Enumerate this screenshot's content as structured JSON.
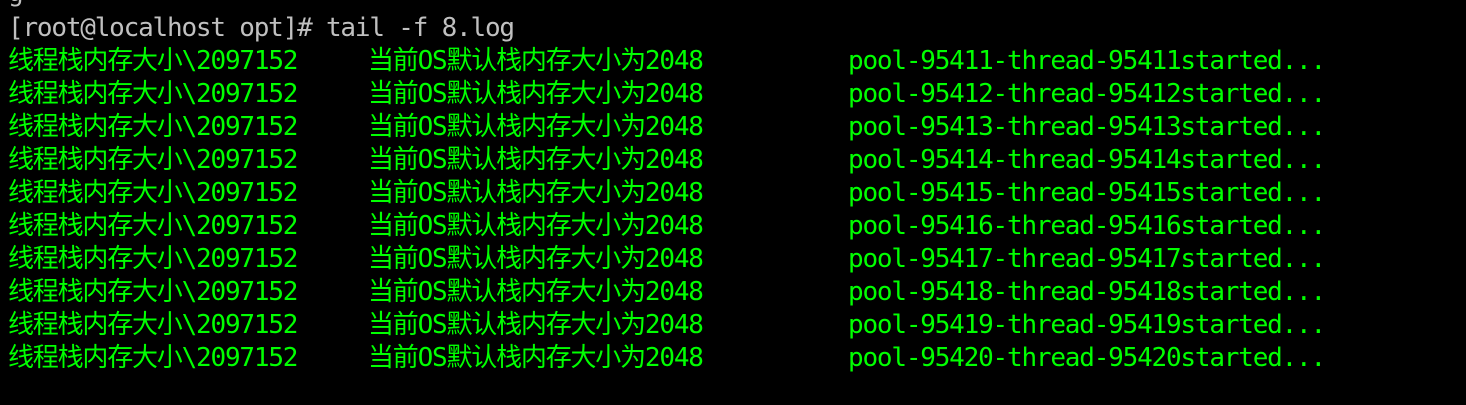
{
  "theme": {
    "background": "#000000",
    "prompt_color": "#c0c0c0",
    "output_color": "#00ff00"
  },
  "terminal": {
    "partial_top_line": "g",
    "prompt": "[root@localhost opt]# tail -f 8.log",
    "log_lines": [
      {
        "stack_size": "线程栈内存大小\\2097152",
        "os_default": "当前OS默认栈内存大小为2048",
        "thread": "pool-95411-thread-95411started..."
      },
      {
        "stack_size": "线程栈内存大小\\2097152",
        "os_default": "当前OS默认栈内存大小为2048",
        "thread": "pool-95412-thread-95412started..."
      },
      {
        "stack_size": "线程栈内存大小\\2097152",
        "os_default": "当前OS默认栈内存大小为2048",
        "thread": "pool-95413-thread-95413started..."
      },
      {
        "stack_size": "线程栈内存大小\\2097152",
        "os_default": "当前OS默认栈内存大小为2048",
        "thread": "pool-95414-thread-95414started..."
      },
      {
        "stack_size": "线程栈内存大小\\2097152",
        "os_default": "当前OS默认栈内存大小为2048",
        "thread": "pool-95415-thread-95415started..."
      },
      {
        "stack_size": "线程栈内存大小\\2097152",
        "os_default": "当前OS默认栈内存大小为2048",
        "thread": "pool-95416-thread-95416started..."
      },
      {
        "stack_size": "线程栈内存大小\\2097152",
        "os_default": "当前OS默认栈内存大小为2048",
        "thread": "pool-95417-thread-95417started..."
      },
      {
        "stack_size": "线程栈内存大小\\2097152",
        "os_default": "当前OS默认栈内存大小为2048",
        "thread": "pool-95418-thread-95418started..."
      },
      {
        "stack_size": "线程栈内存大小\\2097152",
        "os_default": "当前OS默认栈内存大小为2048",
        "thread": "pool-95419-thread-95419started..."
      },
      {
        "stack_size": "线程栈内存大小\\2097152",
        "os_default": "当前OS默认栈内存大小为2048",
        "thread": "pool-95420-thread-95420started..."
      }
    ]
  }
}
